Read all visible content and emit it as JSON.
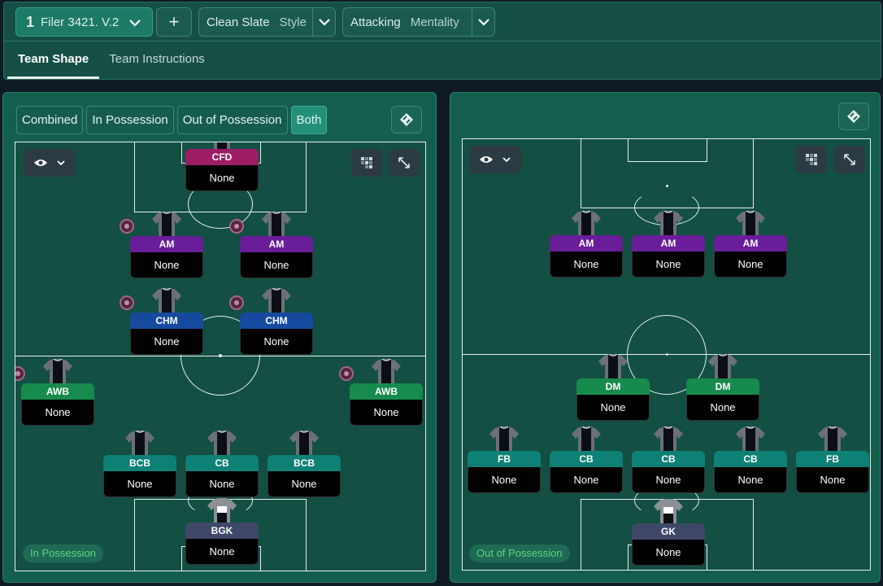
{
  "header": {
    "tactic": {
      "number": "1",
      "name": "Filer 3421. V.2"
    },
    "add_label": "+",
    "style": {
      "value": "Clean Slate",
      "label": "Style"
    },
    "mentality": {
      "value": "Attacking",
      "label": "Mentality"
    }
  },
  "tabs": [
    {
      "label": "Team Shape",
      "active": true
    },
    {
      "label": "Team Instructions",
      "active": false
    }
  ],
  "left_panel": {
    "phase_buttons": [
      {
        "label": "Combined",
        "active": false
      },
      {
        "label": "In Possession",
        "active": false
      },
      {
        "label": "Out of Possession",
        "active": false
      },
      {
        "label": "Both",
        "active": true
      }
    ],
    "mode_badge": "In Possession",
    "players": [
      {
        "role": "CFD",
        "duty": "None",
        "color": "#9c1d63",
        "ball": false
      },
      {
        "role": "AM",
        "duty": "None",
        "color": "#6a1d99",
        "ball": true
      },
      {
        "role": "AM",
        "duty": "None",
        "color": "#6a1d99",
        "ball": true
      },
      {
        "role": "CHM",
        "duty": "None",
        "color": "#164a9e",
        "ball": true
      },
      {
        "role": "CHM",
        "duty": "None",
        "color": "#164a9e",
        "ball": true
      },
      {
        "role": "AWB",
        "duty": "None",
        "color": "#178a4e",
        "ball": true
      },
      {
        "role": "AWB",
        "duty": "None",
        "color": "#178a4e",
        "ball": true
      },
      {
        "role": "BCB",
        "duty": "None",
        "color": "#0e8075",
        "ball": false
      },
      {
        "role": "CB",
        "duty": "None",
        "color": "#0e8075",
        "ball": false
      },
      {
        "role": "BCB",
        "duty": "None",
        "color": "#0e8075",
        "ball": false
      },
      {
        "role": "BGK",
        "duty": "None",
        "color": "#3f4868",
        "ball": false
      }
    ]
  },
  "right_panel": {
    "mode_badge": "Out of Possession",
    "players": [
      {
        "role": "AM",
        "duty": "None",
        "color": "#6a1d99"
      },
      {
        "role": "AM",
        "duty": "None",
        "color": "#6a1d99"
      },
      {
        "role": "AM",
        "duty": "None",
        "color": "#6a1d99"
      },
      {
        "role": "DM",
        "duty": "None",
        "color": "#178a4e"
      },
      {
        "role": "DM",
        "duty": "None",
        "color": "#178a4e"
      },
      {
        "role": "FB",
        "duty": "None",
        "color": "#0e8075"
      },
      {
        "role": "CB",
        "duty": "None",
        "color": "#0e8075"
      },
      {
        "role": "CB",
        "duty": "None",
        "color": "#0e8075"
      },
      {
        "role": "CB",
        "duty": "None",
        "color": "#0e8075"
      },
      {
        "role": "FB",
        "duty": "None",
        "color": "#0e8075"
      },
      {
        "role": "GK",
        "duty": "None",
        "color": "#3f4868"
      }
    ]
  },
  "icons": {
    "chevron": "chevron-down-icon",
    "swap": "swap-icon",
    "eye": "eye-icon",
    "grid": "grid-icon",
    "expand": "expand-icon"
  }
}
